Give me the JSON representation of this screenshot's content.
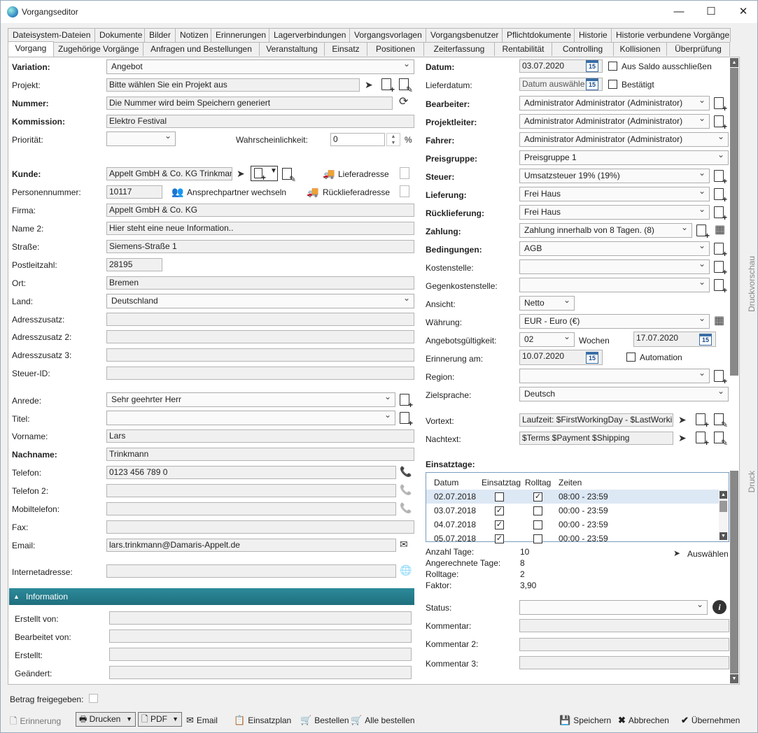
{
  "window": {
    "title": "Vorgangseditor",
    "min": "—",
    "max": "☐",
    "close": "✕"
  },
  "tabs_row1": [
    "Dateisystem-Dateien",
    "Dokumente",
    "Bilder",
    "Notizen",
    "Erinnerungen",
    "Lagerverbindungen",
    "Vorgangsvorlagen",
    "Vorgangsbenutzer",
    "Pflichtdokumente",
    "Historie",
    "Historie verbundene Vorgänge"
  ],
  "tabs_row2": [
    "Vorgang",
    "Zugehörige Vorgänge",
    "Anfragen und Bestellungen",
    "Veranstaltung",
    "Einsatz",
    "Positionen",
    "Zeiterfassung",
    "Rentabilität",
    "Controlling",
    "Kollisionen",
    "Überprüfung"
  ],
  "left": {
    "variation": {
      "label": "Variation:",
      "value": "Angebot"
    },
    "projekt": {
      "label": "Projekt:",
      "value": "Bitte wählen Sie ein Projekt aus"
    },
    "nummer": {
      "label": "Nummer:",
      "value": "Die Nummer wird beim Speichern generiert"
    },
    "kommission": {
      "label": "Kommission:",
      "value": "Elektro Festival"
    },
    "prioritaet": {
      "label": "Priorität:",
      "value": ""
    },
    "wahrscheinlichkeit": {
      "label": "Wahrscheinlichkeit:",
      "value": "0",
      "unit": "%"
    },
    "kunde": {
      "label": "Kunde:",
      "value": "Appelt GmbH & Co. KG Trinkman"
    },
    "lieferadresse": "Lieferadresse",
    "personennummer": {
      "label": "Personennummer:",
      "value": "10117"
    },
    "ansprechpartner": "Ansprechpartner wechseln",
    "ruecklieferadresse": "Rücklieferadresse",
    "firma": {
      "label": "Firma:",
      "value": "Appelt GmbH & Co. KG"
    },
    "name2": {
      "label": "Name 2:",
      "value": "Hier steht eine neue Information.."
    },
    "strasse": {
      "label": "Straße:",
      "value": "Siemens-Straße 1"
    },
    "plz": {
      "label": "Postleitzahl:",
      "value": "28195"
    },
    "ort": {
      "label": "Ort:",
      "value": "Bremen"
    },
    "land": {
      "label": "Land:",
      "value": "Deutschland"
    },
    "adresszusatz": {
      "label": "Adresszusatz:",
      "value": ""
    },
    "adresszusatz2": {
      "label": "Adresszusatz 2:",
      "value": ""
    },
    "adresszusatz3": {
      "label": "Adresszusatz 3:",
      "value": ""
    },
    "steuerid": {
      "label": "Steuer-ID:",
      "value": ""
    },
    "anrede": {
      "label": "Anrede:",
      "value": "Sehr geehrter Herr"
    },
    "titel": {
      "label": "Titel:",
      "value": ""
    },
    "vorname": {
      "label": "Vorname:",
      "value": "Lars"
    },
    "nachname": {
      "label": "Nachname:",
      "value": "Trinkmann"
    },
    "telefon": {
      "label": "Telefon:",
      "value": "0123 456 789 0"
    },
    "telefon2": {
      "label": "Telefon 2:",
      "value": ""
    },
    "mobil": {
      "label": "Mobiltelefon:",
      "value": ""
    },
    "fax": {
      "label": "Fax:",
      "value": ""
    },
    "email": {
      "label": "Email:",
      "value": "lars.trinkmann@Damaris-Appelt.de"
    },
    "internet": {
      "label": "Internetadresse:",
      "value": ""
    }
  },
  "info": {
    "header": "Information",
    "erstellt_von": "Erstellt von:",
    "bearbeitet_von": "Bearbeitet von:",
    "erstellt": "Erstellt:",
    "geaendert": "Geändert:"
  },
  "right": {
    "datum": {
      "label": "Datum:",
      "value": "03.07.2020",
      "cal": "15"
    },
    "aus_saldo": "Aus Saldo ausschließen",
    "lieferdatum": {
      "label": "Lieferdatum:",
      "placeholder": "Datum auswähle"
    },
    "bestaetigt": "Bestätigt",
    "bearbeiter": {
      "label": "Bearbeiter:",
      "value": "Administrator Administrator (Administrator)"
    },
    "projektleiter": {
      "label": "Projektleiter:",
      "value": "Administrator Administrator (Administrator)"
    },
    "fahrer": {
      "label": "Fahrer:",
      "value": "Administrator Administrator (Administrator)"
    },
    "preisgruppe": {
      "label": "Preisgruppe:",
      "value": "Preisgruppe 1"
    },
    "steuer": {
      "label": "Steuer:",
      "value": "Umsatzsteuer 19% (19%)"
    },
    "lieferung": {
      "label": "Lieferung:",
      "value": "Frei Haus"
    },
    "ruecklieferung": {
      "label": "Rücklieferung:",
      "value": "Frei Haus"
    },
    "zahlung": {
      "label": "Zahlung:",
      "value": "Zahlung innerhalb von 8 Tagen. (8)"
    },
    "bedingungen": {
      "label": "Bedingungen:",
      "value": "AGB"
    },
    "kostenstelle": {
      "label": "Kostenstelle:",
      "value": ""
    },
    "gegenkostenstelle": {
      "label": "Gegenkostenstelle:",
      "value": ""
    },
    "ansicht": {
      "label": "Ansicht:",
      "value": "Netto"
    },
    "waehrung": {
      "label": "Währung:",
      "value": "EUR - Euro (€)"
    },
    "gueltigkeit": {
      "label": "Angebotsgültigkeit:",
      "value": "02",
      "unit": "Wochen",
      "date": "17.07.2020"
    },
    "erinnerung": {
      "label": "Erinnerung am:",
      "value": "10.07.2020"
    },
    "automation": "Automation",
    "region": {
      "label": "Region:",
      "value": ""
    },
    "zielsprache": {
      "label": "Zielsprache:",
      "value": "Deutsch"
    },
    "vortext": {
      "label": "Vortext:",
      "value": "Laufzeit: $FirstWorkingDay - $LastWorkin"
    },
    "nachtext": {
      "label": "Nachtext:",
      "value": "$Terms $Payment $Shipping"
    },
    "einsatztage": "Einsatztage:",
    "table": {
      "headers": [
        "Datum",
        "Einsatztag",
        "Rolltag",
        "Zeiten"
      ],
      "rows": [
        {
          "datum": "02.07.2018",
          "einsatz": false,
          "roll": true,
          "zeiten": "08:00 - 23:59"
        },
        {
          "datum": "03.07.2018",
          "einsatz": true,
          "roll": false,
          "zeiten": "00:00 - 23:59"
        },
        {
          "datum": "04.07.2018",
          "einsatz": true,
          "roll": false,
          "zeiten": "00:00 - 23:59"
        },
        {
          "datum": "05.07.2018",
          "einsatz": true,
          "roll": false,
          "zeiten": "00:00 - 23:59"
        }
      ]
    },
    "anzahl_tage": {
      "label": "Anzahl Tage:",
      "value": "10"
    },
    "angerechnete": {
      "label": "Angerechnete Tage:",
      "value": "8"
    },
    "rolltage": {
      "label": "Rolltage:",
      "value": "2"
    },
    "faktor": {
      "label": "Faktor:",
      "value": "3,90"
    },
    "auswaehlen": "Auswählen",
    "status": {
      "label": "Status:",
      "value": ""
    },
    "kommentar": {
      "label": "Kommentar:",
      "value": ""
    },
    "kommentar2": {
      "label": "Kommentar 2:",
      "value": ""
    },
    "kommentar3": {
      "label": "Kommentar 3:",
      "value": ""
    }
  },
  "side": {
    "druckvorschau": "Druckvorschau",
    "druck": "Druck"
  },
  "footer": {
    "betrag": "Betrag freigegeben:",
    "erinnerung": "Erinnerung",
    "drucken": "Drucken",
    "pdf": "PDF",
    "email": "Email",
    "einsatzplan": "Einsatzplan",
    "bestellen": "Bestellen",
    "alle_bestellen": "Alle bestellen",
    "speichern": "Speichern",
    "abbrechen": "Abbrechen",
    "uebernehmen": "Übernehmen"
  }
}
